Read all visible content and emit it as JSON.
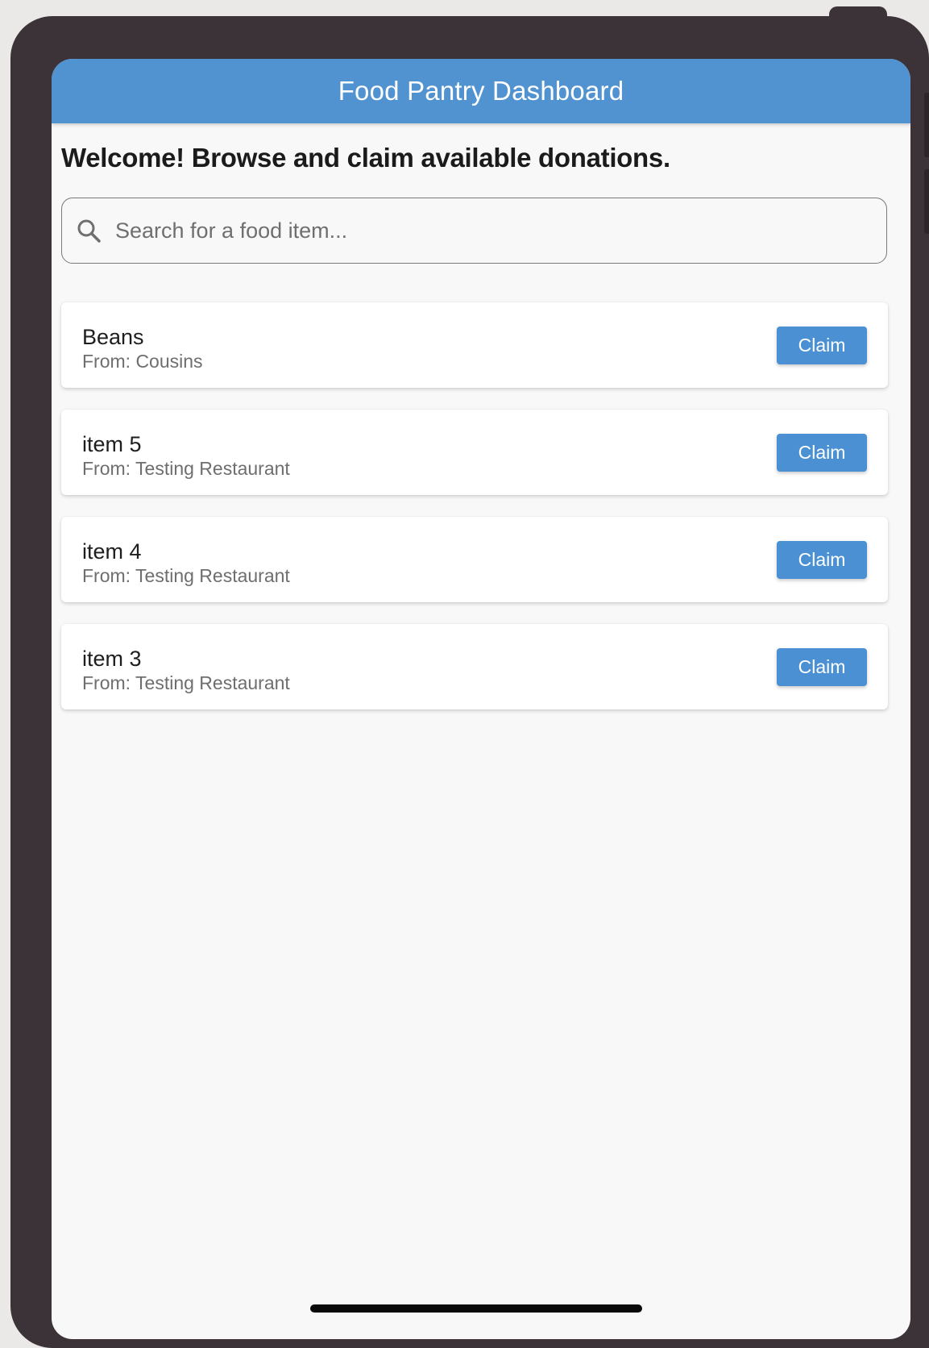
{
  "appbar": {
    "title": "Food Pantry Dashboard",
    "color": "#5093d0"
  },
  "welcome": {
    "text": "Welcome! Browse and claim available donations."
  },
  "search": {
    "placeholder": "Search for a food item...",
    "value": "",
    "icon": "search-icon"
  },
  "donations": [
    {
      "name": "Beans",
      "from": "From: Cousins",
      "claim_label": "Claim"
    },
    {
      "name": "item 5",
      "from": "From: Testing Restaurant",
      "claim_label": "Claim"
    },
    {
      "name": "item 4",
      "from": "From: Testing Restaurant",
      "claim_label": "Claim"
    },
    {
      "name": "item 3",
      "from": "From: Testing Restaurant",
      "claim_label": "Claim"
    }
  ],
  "colors": {
    "accent": "#4a90d2",
    "device_frame": "#3b3337",
    "screen_background": "#f8f8f8"
  }
}
